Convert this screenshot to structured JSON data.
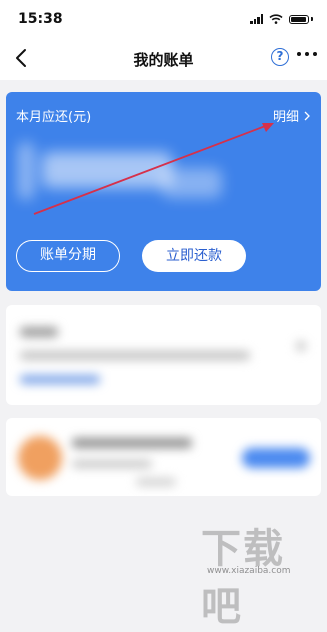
{
  "status_bar": {
    "time": "15:38"
  },
  "nav": {
    "title": "我的账单",
    "help_symbol": "?"
  },
  "bill_card": {
    "label": "本月应还(元)",
    "detail_link": "明细",
    "installment_button": "账单分期",
    "repay_button": "立即还款",
    "accent_color": "#3e82ea",
    "annotation_arrow_color": "#d6304a"
  },
  "watermark": {
    "text": "下载吧",
    "url": "www.xiazaiba.com"
  }
}
